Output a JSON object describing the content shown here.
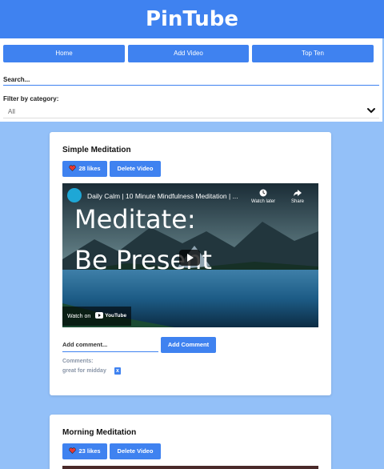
{
  "app": {
    "title": "PinTube"
  },
  "nav": [
    {
      "label": "Home"
    },
    {
      "label": "Add Video"
    },
    {
      "label": "Top Ten"
    }
  ],
  "search": {
    "placeholder": "Search...",
    "value": ""
  },
  "filter": {
    "label": "Filter by category:",
    "selected": "All"
  },
  "videos": [
    {
      "title": "Simple Meditation",
      "likes_label": "28 likes",
      "delete_label": "Delete Video",
      "embed": {
        "title": "Daily Calm | 10 Minute Mindfulness Meditation | ...",
        "overlay_line1": "Meditate:",
        "overlay_line2": "Be Present",
        "watch_later": "Watch later",
        "share": "Share",
        "watch_on": "Watch on",
        "youtube": "YouTube"
      },
      "comment_placeholder": "Add comment...",
      "add_comment_label": "Add Comment",
      "comments_label": "Comments:",
      "comments": [
        {
          "text": "great for midday",
          "delete_label": "x"
        }
      ]
    },
    {
      "title": "Morning Meditation",
      "likes_label": "23 likes",
      "delete_label": "Delete Video"
    }
  ],
  "colors": {
    "accent": "#3f82f0",
    "background": "#93c0f8",
    "card": "#ffffff"
  }
}
